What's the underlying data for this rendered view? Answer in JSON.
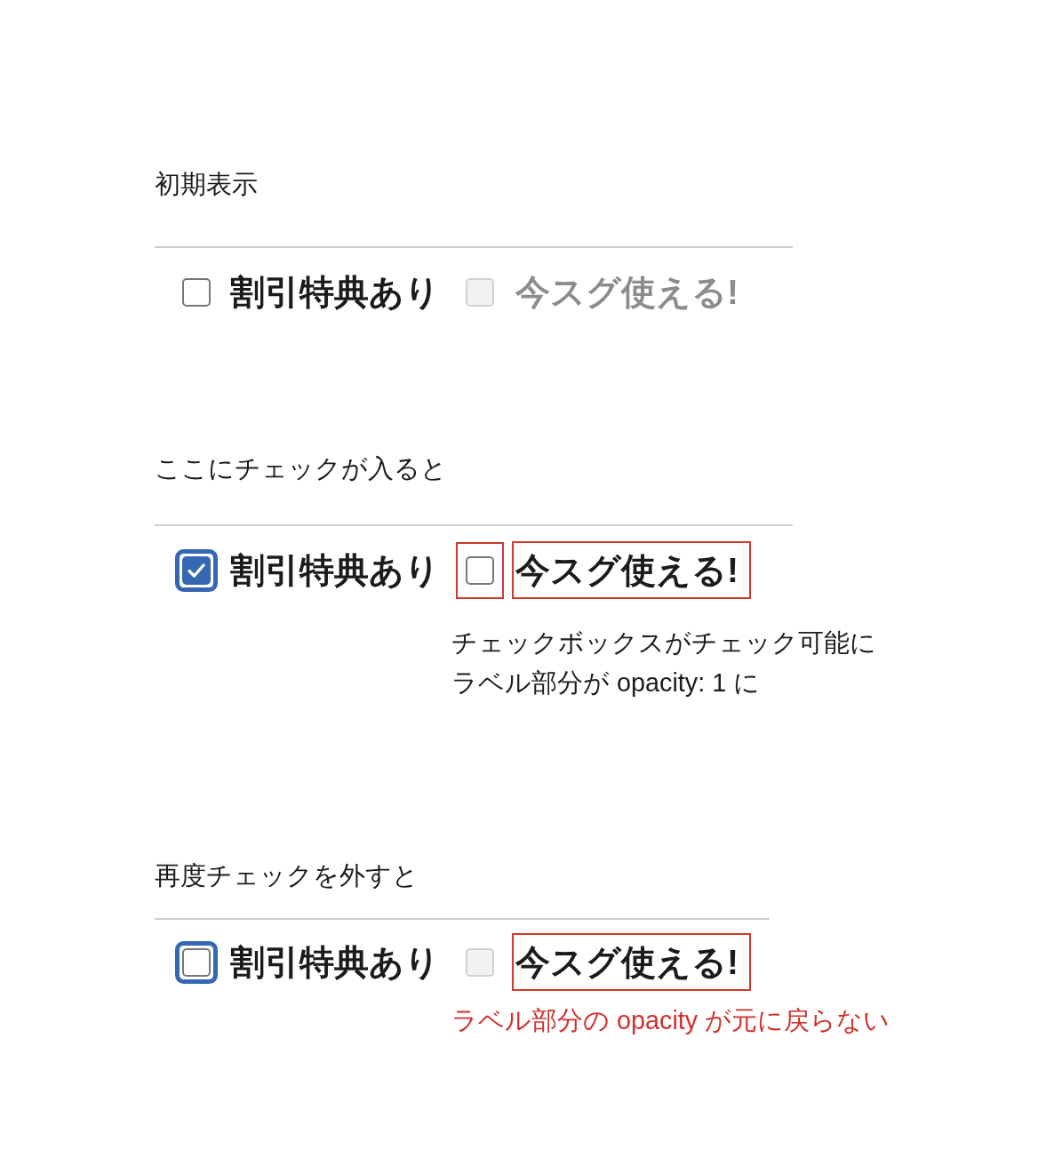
{
  "sections": [
    {
      "heading": "初期表示",
      "options": [
        {
          "label": "割引特典あり",
          "checked": false,
          "disabled": false,
          "focused": false,
          "checkbox_highlighted": false,
          "label_highlighted": false,
          "label_dimmed": false
        },
        {
          "label": "今スグ使える!",
          "checked": false,
          "disabled": true,
          "focused": false,
          "checkbox_highlighted": false,
          "label_highlighted": false,
          "label_dimmed": true
        }
      ]
    },
    {
      "heading": "ここにチェックが入ると",
      "options": [
        {
          "label": "割引特典あり",
          "checked": true,
          "disabled": false,
          "focused": true,
          "checkbox_highlighted": false,
          "label_highlighted": false,
          "label_dimmed": false
        },
        {
          "label": "今スグ使える!",
          "checked": false,
          "disabled": false,
          "focused": false,
          "checkbox_highlighted": true,
          "label_highlighted": true,
          "label_dimmed": false
        }
      ],
      "note": {
        "kind": "explanation",
        "lines": [
          "チェックボックスがチェック可能に",
          "ラベル部分が opacity: 1 に"
        ]
      }
    },
    {
      "heading": "再度チェックを外すと",
      "options": [
        {
          "label": "割引特典あり",
          "checked": false,
          "disabled": false,
          "focused": true,
          "checkbox_highlighted": false,
          "label_highlighted": false,
          "label_dimmed": false
        },
        {
          "label": "今スグ使える!",
          "checked": false,
          "disabled": true,
          "focused": false,
          "checkbox_highlighted": false,
          "label_highlighted": true,
          "label_dimmed": false
        }
      ],
      "note": {
        "kind": "problem",
        "lines": [
          "ラベル部分の opacity が元に戻らない"
        ]
      }
    }
  ]
}
